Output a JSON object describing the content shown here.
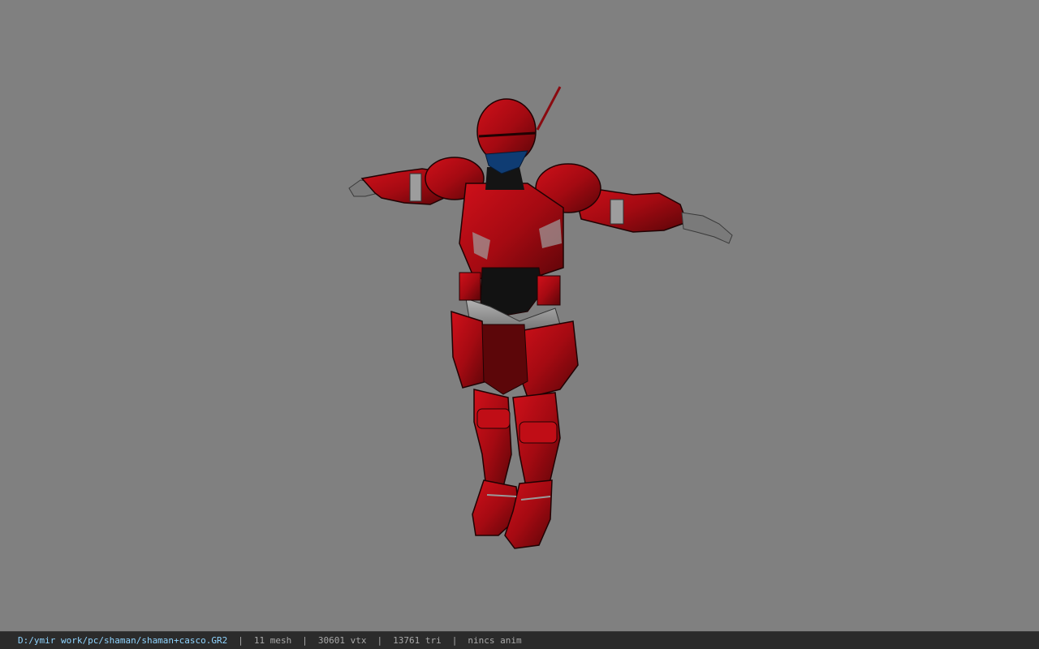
{
  "viewer": {
    "background_color": "#808080",
    "model": {
      "name": "shaman+casco",
      "pose": "t-pose",
      "armor_color": "#b30b12",
      "visor_color": "#0f3c73",
      "skin_color": "#8a8a8a"
    }
  },
  "status_bar": {
    "file_path": "D:/ymir work/pc/shaman/shaman+casco.GR2",
    "separator": "|",
    "mesh_count": "11 mesh",
    "vertex_count": "30601 vtx",
    "triangle_count": "13761 tri",
    "anim_status": "nincs anim"
  }
}
